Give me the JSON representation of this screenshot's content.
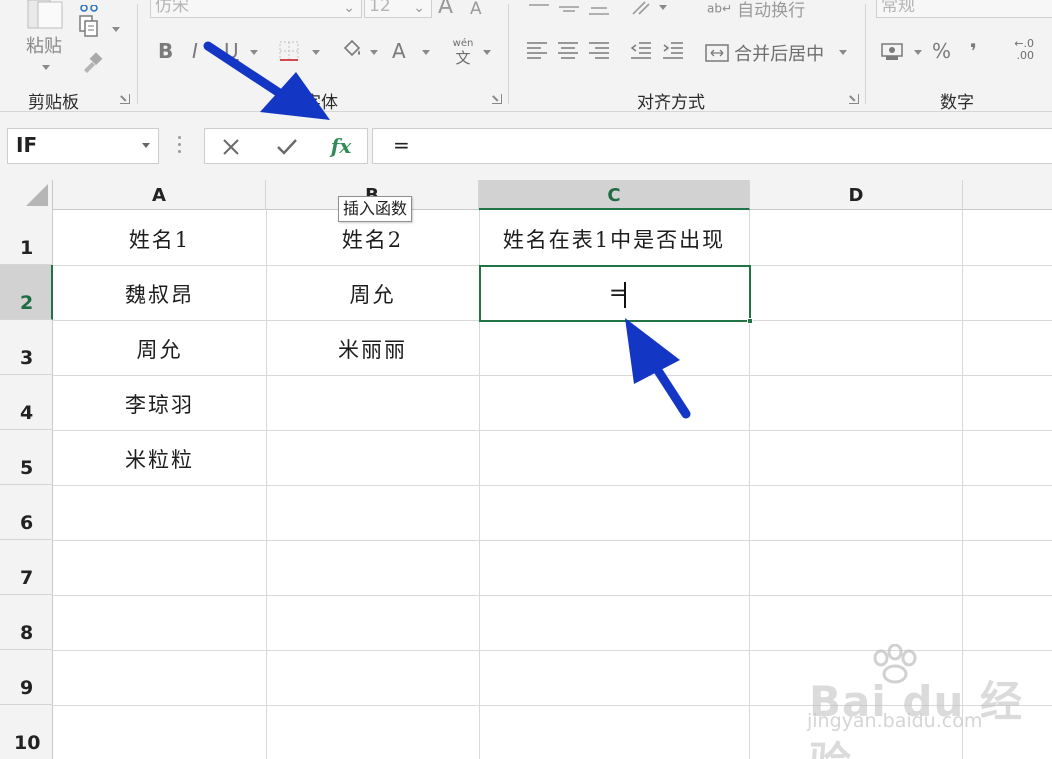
{
  "ribbon": {
    "clipboard": {
      "paste_label": "粘贴",
      "group_label": "剪贴板"
    },
    "font": {
      "font_name": "仿宋",
      "font_size": "12",
      "bold_label": "B",
      "italic_label": "I",
      "underline_label": "U",
      "pinyin_label": "wén",
      "pinyin_sub": "文",
      "group_label": "字体",
      "increase_label": "A",
      "decrease_label": "A"
    },
    "alignment": {
      "wrap_text_label": "自动换行",
      "merge_center_label": "合并后居中",
      "group_label": "对齐方式"
    },
    "number": {
      "format_value": "常规",
      "percent_label": "%",
      "comma_label": "❜",
      "decimal_increase": "←.0\n.00",
      "group_label": "数字"
    }
  },
  "formula_bar": {
    "name_box": "IF",
    "formula": "=",
    "cancel_icon": "✕",
    "enter_icon": "✓",
    "fx_label": "fx"
  },
  "tooltip": {
    "text": "插入函数"
  },
  "sheet": {
    "columns": [
      "A",
      "B",
      "C",
      "D"
    ],
    "rows": [
      "1",
      "2",
      "3",
      "4",
      "5",
      "6",
      "7",
      "8",
      "9",
      "10"
    ],
    "active_column": "C",
    "active_row": "2",
    "cells": {
      "A1": "姓名1",
      "B1": "姓名2",
      "C1": "姓名在表1中是否出现",
      "A2": "魏叔昂",
      "B2": "周允",
      "C2": "=",
      "A3": "周允",
      "B3": "米丽丽",
      "A4": "李琼羽",
      "A5": "米粒粒"
    }
  },
  "watermark": {
    "text": "Bai du 经验",
    "url": "jingyan.baidu.com"
  },
  "colors": {
    "excel_green": "#217346",
    "annotation_arrow": "#1436c4",
    "ribbon_bg": "#f3f3f3"
  }
}
